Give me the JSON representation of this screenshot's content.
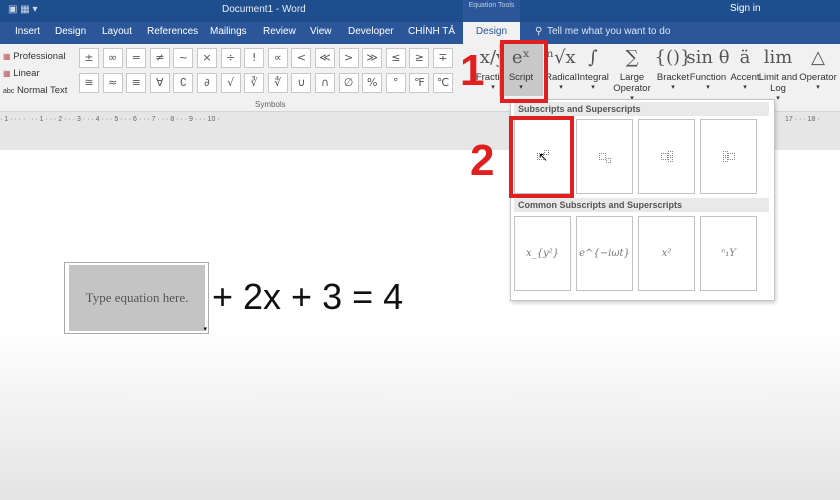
{
  "window": {
    "title": "Document1  -  Word",
    "context": "Equation Tools",
    "sign_in": "Sign in"
  },
  "tabs": [
    "Insert",
    "Design",
    "Layout",
    "References",
    "Mailings",
    "Review",
    "View",
    "Developer",
    "CHÍNH TẢ",
    "Design"
  ],
  "tell_me": "Tell me what you want to do",
  "conversions": [
    "Professional",
    "Linear",
    "Normal Text"
  ],
  "symbols": {
    "label": "Symbols",
    "row1": [
      "±",
      "∞",
      "=",
      "≠",
      "~",
      "×",
      "÷",
      "!",
      "∝",
      "<",
      "≪",
      ">",
      "≫",
      "≤",
      "≥",
      "∓"
    ],
    "row2": [
      "≅",
      "≈",
      "≡",
      "∀",
      "∁",
      "∂",
      "√",
      "∛",
      "∜",
      "∪",
      "∩",
      "∅",
      "%",
      "°",
      "℉",
      "℃"
    ]
  },
  "structures": [
    {
      "glyph": "x/y",
      "label": "Fraction"
    },
    {
      "glyph": "eˣ",
      "label": "Script"
    },
    {
      "glyph": "ⁿ√x",
      "label": "Radical"
    },
    {
      "glyph": "∫",
      "label": "Integral"
    },
    {
      "glyph": "∑",
      "label": "Large Operator"
    },
    {
      "glyph": "{()}",
      "label": "Bracket"
    },
    {
      "glyph": "sin θ",
      "label": "Function"
    },
    {
      "glyph": "ä",
      "label": "Accent"
    },
    {
      "glyph": "lim",
      "label": "Limit and Log"
    },
    {
      "glyph": "△",
      "label": "Operator"
    }
  ],
  "ruler": "· 1 · · · ·   · · 1 · · · 2 · · · 3 · · · 4 · · · 5 · · · 6 · · · 7 · · · 8 · · · 9 · · · 10 ·",
  "ruler_right": "17 · · · 18 ·",
  "dropdown": {
    "section1": "Subscripts and Superscripts",
    "section2": "Common Subscripts and Superscripts",
    "common": [
      "x_{y²}",
      "e^{−iωt}",
      "x²",
      "ⁿ₁Y"
    ]
  },
  "document": {
    "placeholder": "Type equation here.",
    "rest": "+ 2x + 3 = 4"
  },
  "annotations": {
    "step1": "1",
    "step2": "2",
    "color": "#e02020"
  }
}
